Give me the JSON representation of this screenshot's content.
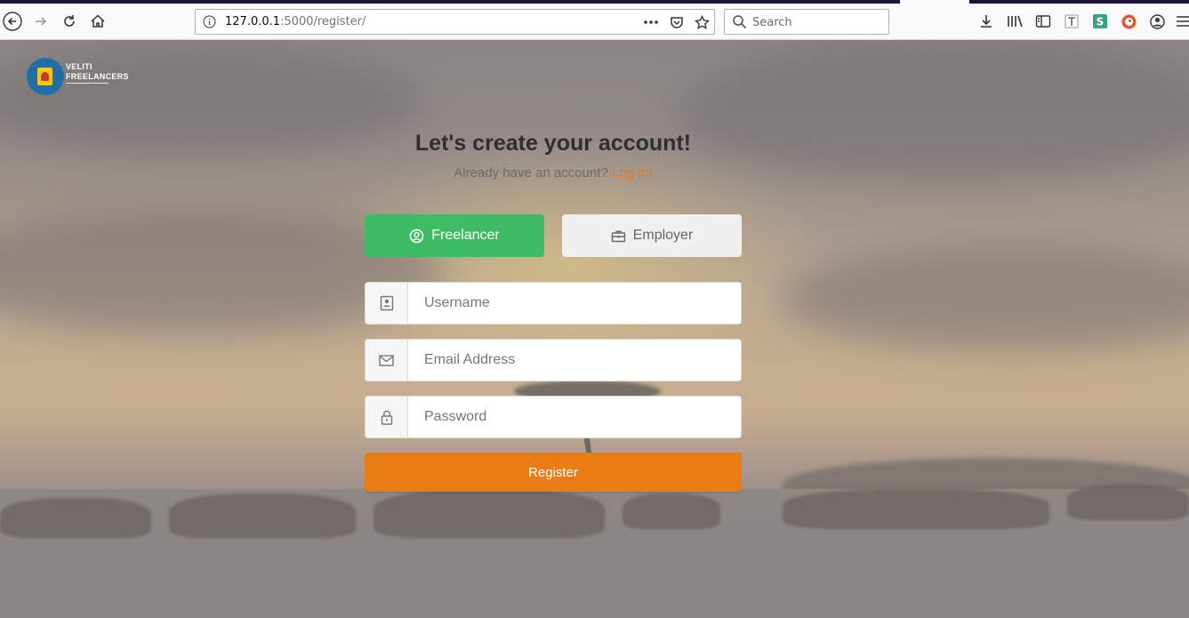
{
  "browser": {
    "url_host": "127.0.0.1",
    "url_path": ":5000/register/",
    "search_placeholder": "Search",
    "icons": [
      "back-icon",
      "forward-icon",
      "reload-icon",
      "home-icon",
      "info-icon",
      "more-icon",
      "pocket-icon",
      "bookmark-star-icon",
      "search-icon",
      "download-icon",
      "library-icon",
      "sidebar-icon",
      "reader-icon",
      "extension-s-icon",
      "duckduckgo-icon",
      "account-icon",
      "menu-icon"
    ]
  },
  "logo": {
    "line1": "VELITI",
    "line2": "FREELANCERS"
  },
  "header": {
    "title": "Let's create your account!",
    "subtitle": "Already have an account?",
    "login_link": "Log In!"
  },
  "roles": {
    "freelancer": "Freelancer",
    "employer": "Employer",
    "selected": "Freelancer"
  },
  "form": {
    "username_placeholder": "Username",
    "email_placeholder": "Email Address",
    "password_placeholder": "Password",
    "username_value": "",
    "email_value": "",
    "password_value": "",
    "submit_label": "Register"
  },
  "colors": {
    "accent_orange": "#ea7c14",
    "freelancer_green": "#3fbb66",
    "employer_gray": "#f0f0f0"
  }
}
